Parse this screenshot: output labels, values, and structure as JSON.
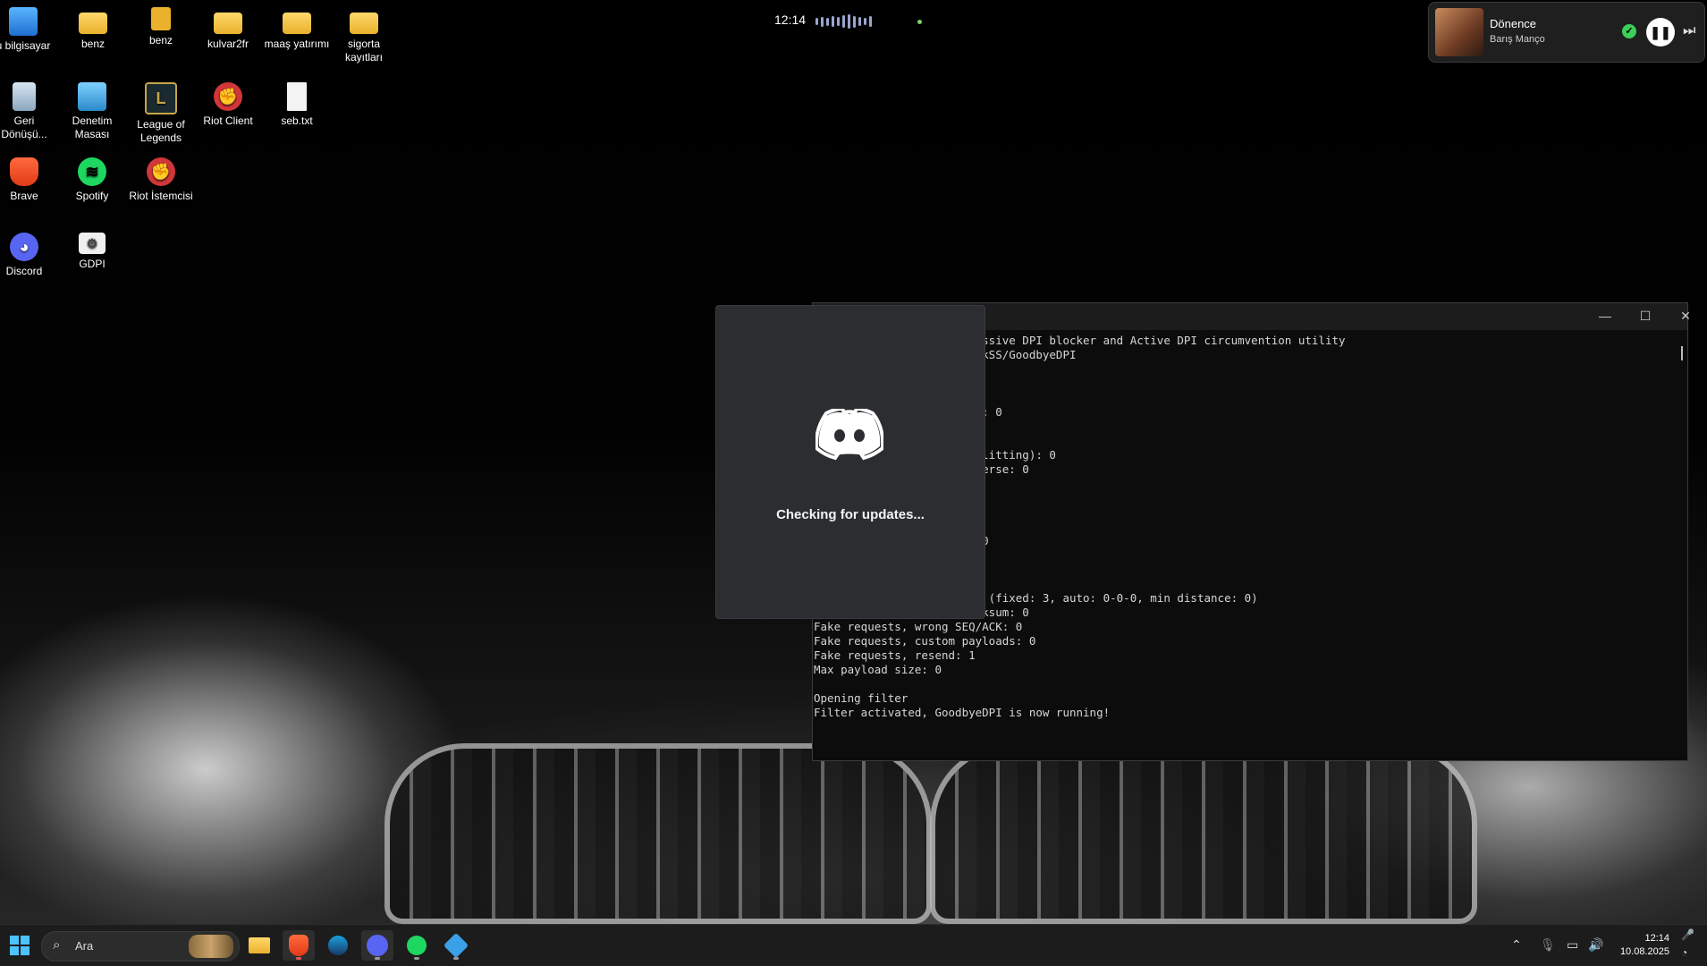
{
  "desktop": {
    "icons": [
      {
        "label": "u bilgisayar"
      },
      {
        "label": "benz"
      },
      {
        "label": "benz"
      },
      {
        "label": "kulvar2fr"
      },
      {
        "label": "maaş yatırımı"
      },
      {
        "label": "sigorta kayıtları"
      },
      {
        "label": "Geri Dönüşü..."
      },
      {
        "label": "Denetim Masası"
      },
      {
        "label": "League of Legends"
      },
      {
        "label": "Riot Client"
      },
      {
        "label": "seb.txt"
      },
      {
        "label": "Brave"
      },
      {
        "label": "Spotify"
      },
      {
        "label": "Riot İstemcisi"
      },
      {
        "label": "Discord"
      },
      {
        "label": "GDPI"
      }
    ]
  },
  "top_widget": {
    "time": "12:14"
  },
  "media": {
    "title": "Dönence",
    "artist": "Barış Manço",
    "accent": "#3ccf5a"
  },
  "terminal": {
    "controls": [
      "—",
      "☐",
      "✕"
    ],
    "lines": [
      "                         ssive DPI blocker and Active DPI circumvention utility",
      "                         kSS/GoodbyeDPI",
      "",
      "",
      "",
      "                         : 0",
      "",
      "",
      "                         litting): 0",
      "                         erse: 0",
      "",
      "",
      "",
      "",
      "                         0",
      "",
      "",
      "",
      "Fake requests, TTL: fixed (fixed: 3, auto: 0-0-0, min distance: 0)",
      "Fake requests, wrong checksum: 0",
      "Fake requests, wrong SEQ/ACK: 0",
      "Fake requests, custom payloads: 0",
      "Fake requests, resend: 1",
      "Max payload size: 0",
      "",
      "Opening filter",
      "Filter activated, GoodbyeDPI is now running!"
    ]
  },
  "discord_updater": {
    "message": "Checking for updates...",
    "brand_color": "#ffffff",
    "bg_color": "#2b2d31"
  },
  "taskbar": {
    "search_placeholder": "Ara",
    "apps": [
      "windows-start",
      "file-explorer",
      "brave",
      "steam",
      "discord",
      "spotify",
      "gdpi"
    ],
    "clock_time": "12:14",
    "clock_date": "10.08.2025"
  }
}
